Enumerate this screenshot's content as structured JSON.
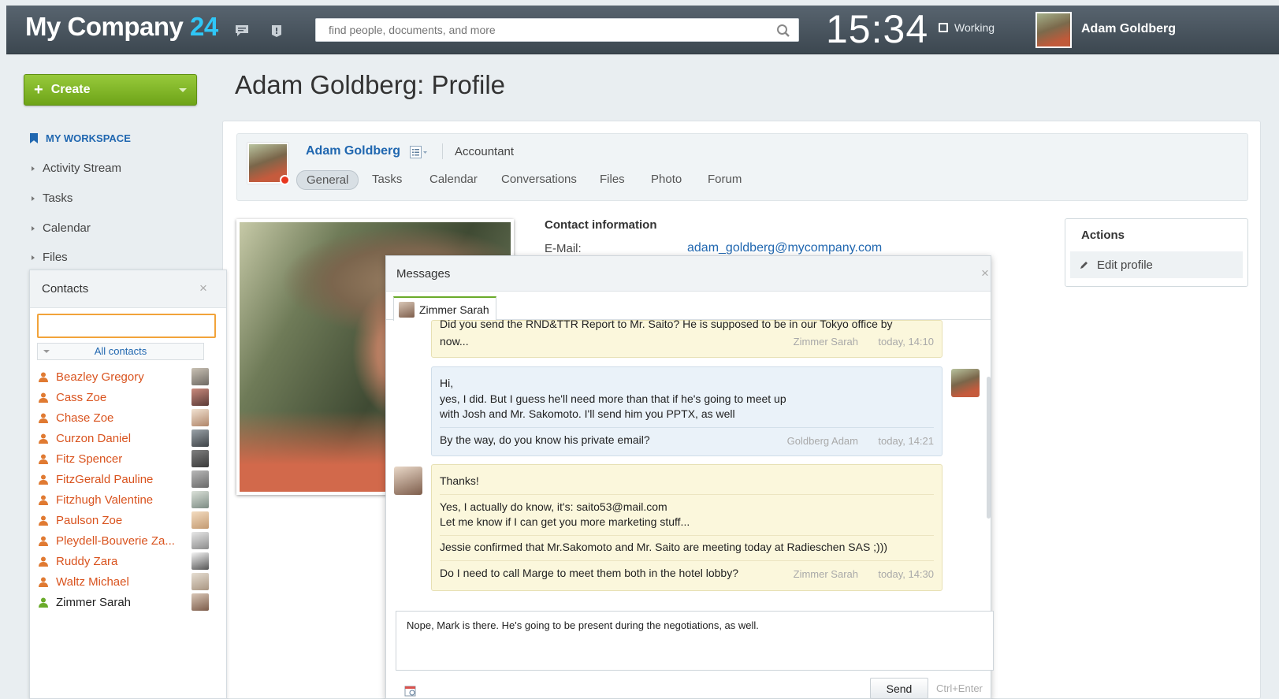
{
  "header": {
    "logo_text": "My Company",
    "logo_number": "24",
    "search_placeholder": "find people, documents, and more",
    "clock": "15:34",
    "status": "Working",
    "user_name": "Adam Goldberg"
  },
  "sidebar": {
    "create_label": "Create",
    "workspace_title": "MY WORKSPACE",
    "items": [
      {
        "label": "Activity Stream"
      },
      {
        "label": "Tasks"
      },
      {
        "label": "Calendar"
      },
      {
        "label": "Files"
      }
    ]
  },
  "page": {
    "title": "Adam Goldberg: Profile"
  },
  "profile": {
    "name": "Adam Goldberg",
    "role": "Accountant",
    "tabs": [
      {
        "label": "General",
        "active": true
      },
      {
        "label": "Tasks"
      },
      {
        "label": "Calendar"
      },
      {
        "label": "Conversations"
      },
      {
        "label": "Files"
      },
      {
        "label": "Photo"
      },
      {
        "label": "Forum"
      }
    ],
    "contact_title": "Contact information",
    "email_label": "E-Mail:",
    "email": "adam_goldberg@mycompany.com"
  },
  "actions": {
    "title": "Actions",
    "edit_profile": "Edit profile"
  },
  "contacts": {
    "title": "Contacts",
    "filter": "All contacts",
    "list": [
      {
        "name": "Beazley Gregory",
        "online": false
      },
      {
        "name": "Cass Zoe",
        "online": false
      },
      {
        "name": "Chase Zoe",
        "online": false
      },
      {
        "name": "Curzon Daniel",
        "online": false
      },
      {
        "name": "Fitz Spencer",
        "online": false
      },
      {
        "name": "FitzGerald Pauline",
        "online": false
      },
      {
        "name": "Fitzhugh Valentine",
        "online": false
      },
      {
        "name": "Paulson Zoe",
        "online": false
      },
      {
        "name": "Pleydell-Bouverie Za...",
        "online": false
      },
      {
        "name": "Ruddy Zara",
        "online": false
      },
      {
        "name": "Waltz Michael",
        "online": false
      },
      {
        "name": "Zimmer Sarah",
        "online": true
      }
    ]
  },
  "messages": {
    "title": "Messages",
    "chat_tab": "Zimmer Sarah",
    "thread": [
      {
        "from": "in",
        "lines": [
          "Did you send the RND&TTR Report to Mr. Saito? He is supposed to be in our Tokyo office by",
          "now..."
        ],
        "author": "Zimmer Sarah",
        "time": "today, 14:10"
      },
      {
        "from": "out",
        "lines": [
          "Hi,",
          "yes, I did. But I guess he'll need more than that if he's going to meet up",
          "with Josh and Mr. Sakomoto. I'll send him you PPTX, as well",
          "By the way, do you know his private email?"
        ],
        "author": "Goldberg Adam",
        "time": "today, 14:21"
      },
      {
        "from": "in",
        "lines": [
          "Thanks!",
          "Yes, I actually do know, it's: saito53@mail.com",
          "Let me know if I can get you more marketing stuff...",
          "Jessie confirmed that Mr.Sakomoto and Mr. Saito are meeting today at Radieschen SAS ;)))",
          "Do I need to call Marge to meet them both in the hotel lobby?"
        ],
        "author": "Zimmer Sarah",
        "time": "today, 14:30"
      }
    ],
    "draft": "Nope, Mark is there. He's going to be present during the negotiations, as well.",
    "send_label": "Send",
    "send_hint": "Ctrl+Enter"
  },
  "colors": {
    "accent_blue": "#2067b0",
    "create_green": "#7cb526",
    "offline_orange": "#d9531e",
    "clock_blue": "#2fc7f7"
  }
}
